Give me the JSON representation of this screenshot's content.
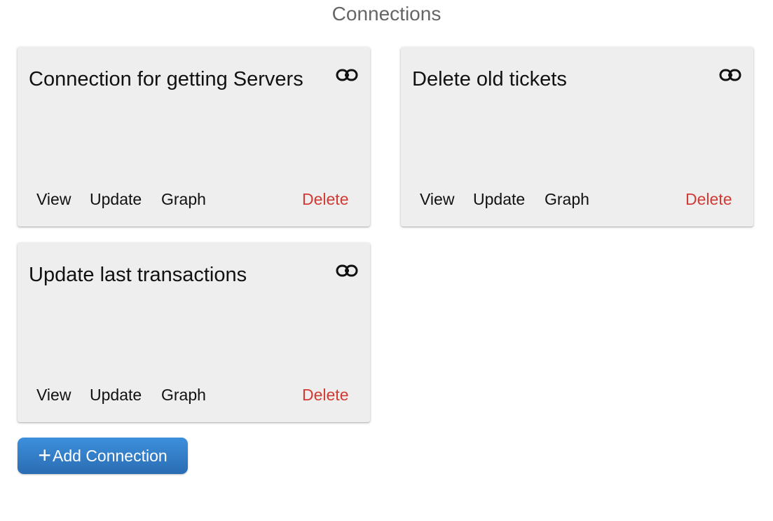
{
  "page": {
    "title": "Connections"
  },
  "cards": [
    {
      "title": "Connection for getting Servers",
      "icon": "link-icon",
      "actions": {
        "view": "View",
        "update": "Update",
        "graph": "Graph",
        "delete": "Delete"
      }
    },
    {
      "title": "Delete old tickets",
      "icon": "link-icon",
      "actions": {
        "view": "View",
        "update": "Update",
        "graph": "Graph",
        "delete": "Delete"
      }
    },
    {
      "title": "Update last transactions",
      "icon": "link-icon",
      "actions": {
        "view": "View",
        "update": "Update",
        "graph": "Graph",
        "delete": "Delete"
      }
    }
  ],
  "add_button": {
    "icon": "plus-icon",
    "label": "Add Connection"
  },
  "colors": {
    "card_background": "#eeeeee",
    "delete_text": "#d23a34",
    "primary_button": "#2f7bc8",
    "title_text": "#666666"
  }
}
